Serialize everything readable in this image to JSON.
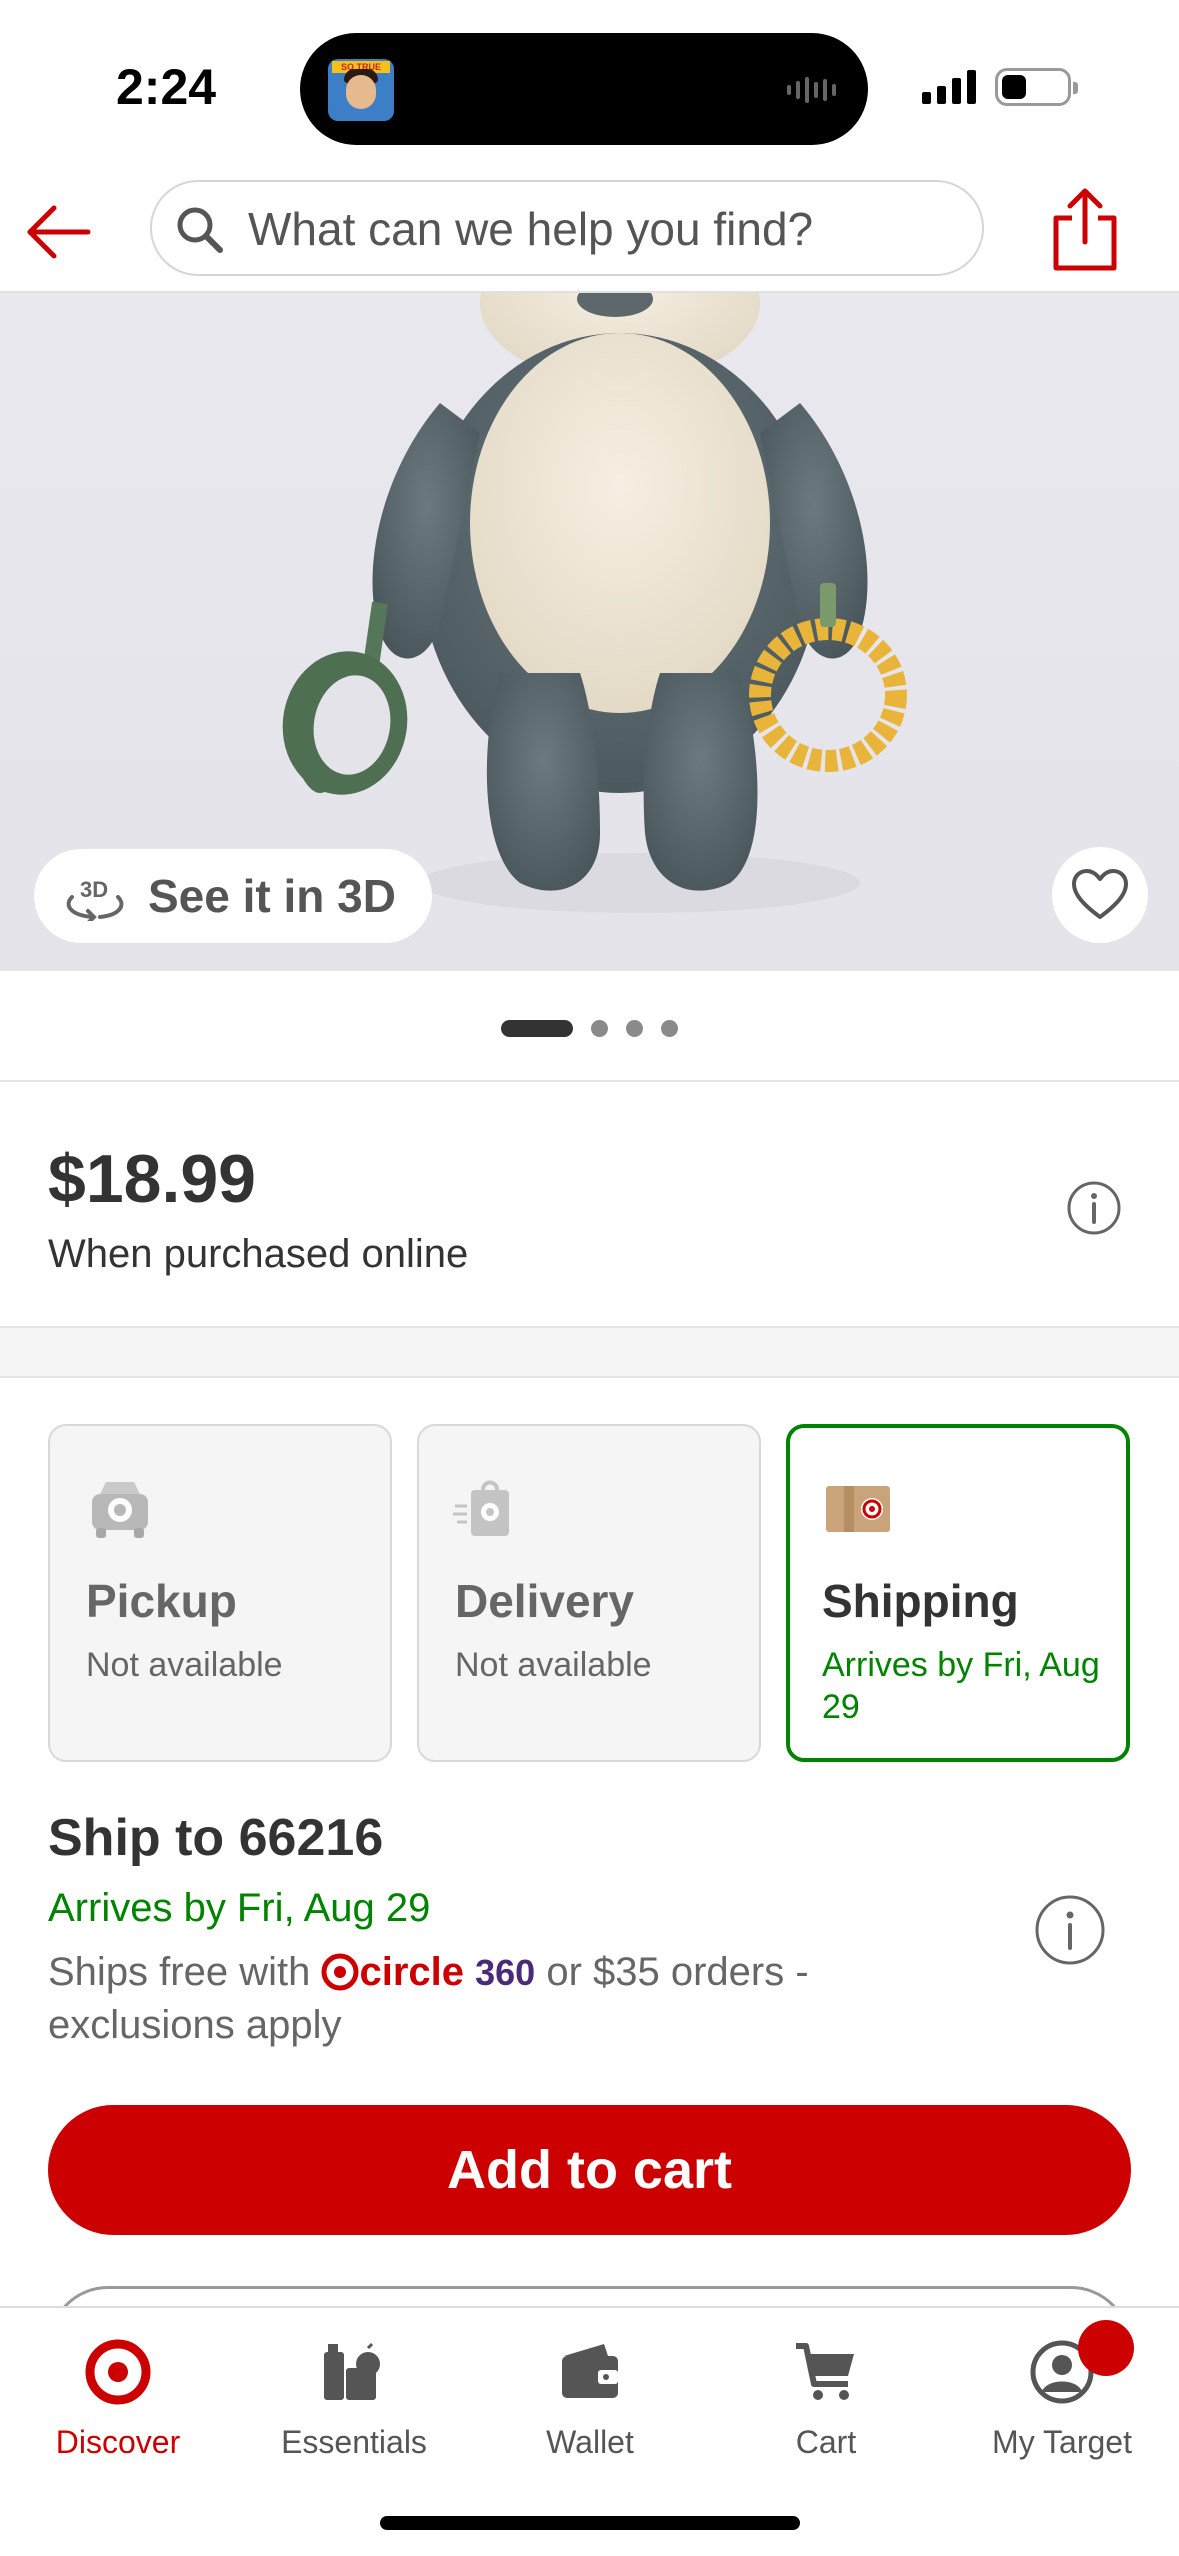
{
  "status_bar": {
    "time": "2:24",
    "island_badge": "SO TRUE"
  },
  "header": {
    "search_placeholder": "What can we help you find?",
    "back_icon": "arrow-left-icon",
    "share_icon": "share-icon"
  },
  "hero": {
    "view_3d_label": "See it in 3D",
    "favorite_icon": "heart-icon",
    "carousel": {
      "count": 4,
      "active_index": 0
    }
  },
  "price": {
    "amount": "$18.99",
    "subtitle": "When purchased online"
  },
  "fulfillment": [
    {
      "title": "Pickup",
      "status": "Not available",
      "selected": false,
      "icon": "pickup-car-icon"
    },
    {
      "title": "Delivery",
      "status": "Not available",
      "selected": false,
      "icon": "delivery-bag-icon"
    },
    {
      "title": "Shipping",
      "status": "Arrives by Fri, Aug 29",
      "selected": true,
      "icon": "shipping-box-icon"
    }
  ],
  "shipping": {
    "title": "Ship to 66216",
    "arrives": "Arrives by Fri, Aug 29",
    "note_prefix": "Ships free with ",
    "circle_word": "circle",
    "circle_360": "360",
    "note_suffix": " or $35 orders - exclusions apply"
  },
  "actions": {
    "add_to_cart": "Add to cart"
  },
  "bottom_nav": [
    {
      "label": "Discover",
      "icon": "target-bullseye-icon",
      "active": true
    },
    {
      "label": "Essentials",
      "icon": "essentials-icon",
      "active": false
    },
    {
      "label": "Wallet",
      "icon": "wallet-icon",
      "active": false
    },
    {
      "label": "Cart",
      "icon": "cart-icon",
      "active": false
    },
    {
      "label": "My Target",
      "icon": "account-icon",
      "active": false
    }
  ],
  "colors": {
    "brand_red": "#cc0000",
    "success_green": "#008300",
    "text_dark": "#333333",
    "text_muted": "#666666"
  }
}
